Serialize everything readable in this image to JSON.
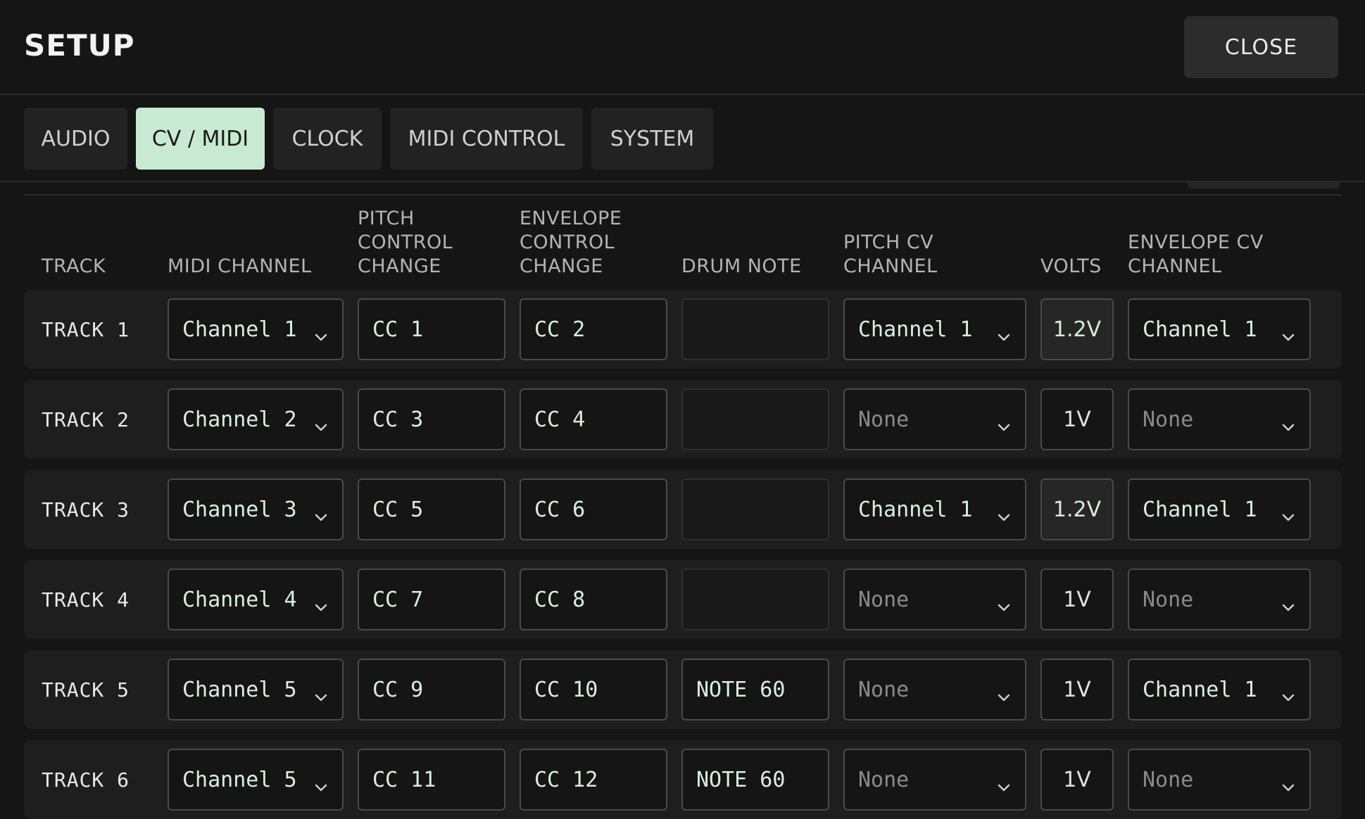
{
  "header": {
    "title": "SETUP",
    "close_label": "CLOSE"
  },
  "tabs": [
    {
      "label": "AUDIO",
      "active": false
    },
    {
      "label": "CV / MIDI",
      "active": true
    },
    {
      "label": "CLOCK",
      "active": false
    },
    {
      "label": "MIDI CONTROL",
      "active": false
    },
    {
      "label": "SYSTEM",
      "active": false
    }
  ],
  "columns": {
    "track": "TRACK",
    "midi_channel": "MIDI CHANNEL",
    "pitch_cc": [
      "PITCH",
      "CONTROL",
      "CHANGE"
    ],
    "env_cc": [
      "ENVELOPE",
      "CONTROL",
      "CHANGE"
    ],
    "drum_note": "DRUM NOTE",
    "pitch_cv": [
      "PITCH CV",
      "CHANNEL"
    ],
    "volts": "VOLTS",
    "env_cv": [
      "ENVELOPE CV",
      "CHANNEL"
    ]
  },
  "rows": [
    {
      "track": "TRACK 1",
      "midi": "Channel 1",
      "pitch_cc": "CC 1",
      "env_cc": "CC 2",
      "drum": "",
      "pitch_cv": "Channel 1",
      "volts": "1.2V",
      "volts_hi": true,
      "env_cv": "Channel 1"
    },
    {
      "track": "TRACK 2",
      "midi": "Channel 2",
      "pitch_cc": "CC 3",
      "env_cc": "CC 4",
      "drum": "",
      "pitch_cv": "None",
      "volts": "1V",
      "volts_hi": false,
      "env_cv": "None"
    },
    {
      "track": "TRACK 3",
      "midi": "Channel 3",
      "pitch_cc": "CC 5",
      "env_cc": "CC 6",
      "drum": "",
      "pitch_cv": "Channel 1",
      "volts": "1.2V",
      "volts_hi": true,
      "env_cv": "Channel 1"
    },
    {
      "track": "TRACK 4",
      "midi": "Channel 4",
      "pitch_cc": "CC 7",
      "env_cc": "CC 8",
      "drum": "",
      "pitch_cv": "None",
      "volts": "1V",
      "volts_hi": false,
      "env_cv": "None"
    },
    {
      "track": "TRACK 5",
      "midi": "Channel 5",
      "pitch_cc": "CC 9",
      "env_cc": "CC 10",
      "drum": "NOTE 60",
      "pitch_cv": "None",
      "volts": "1V",
      "volts_hi": false,
      "env_cv": "Channel 1"
    },
    {
      "track": "TRACK 6",
      "midi": "Channel 5",
      "pitch_cc": "CC 11",
      "env_cc": "CC 12",
      "drum": "NOTE 60",
      "pitch_cv": "None",
      "volts": "1V",
      "volts_hi": false,
      "env_cv": "None"
    }
  ]
}
